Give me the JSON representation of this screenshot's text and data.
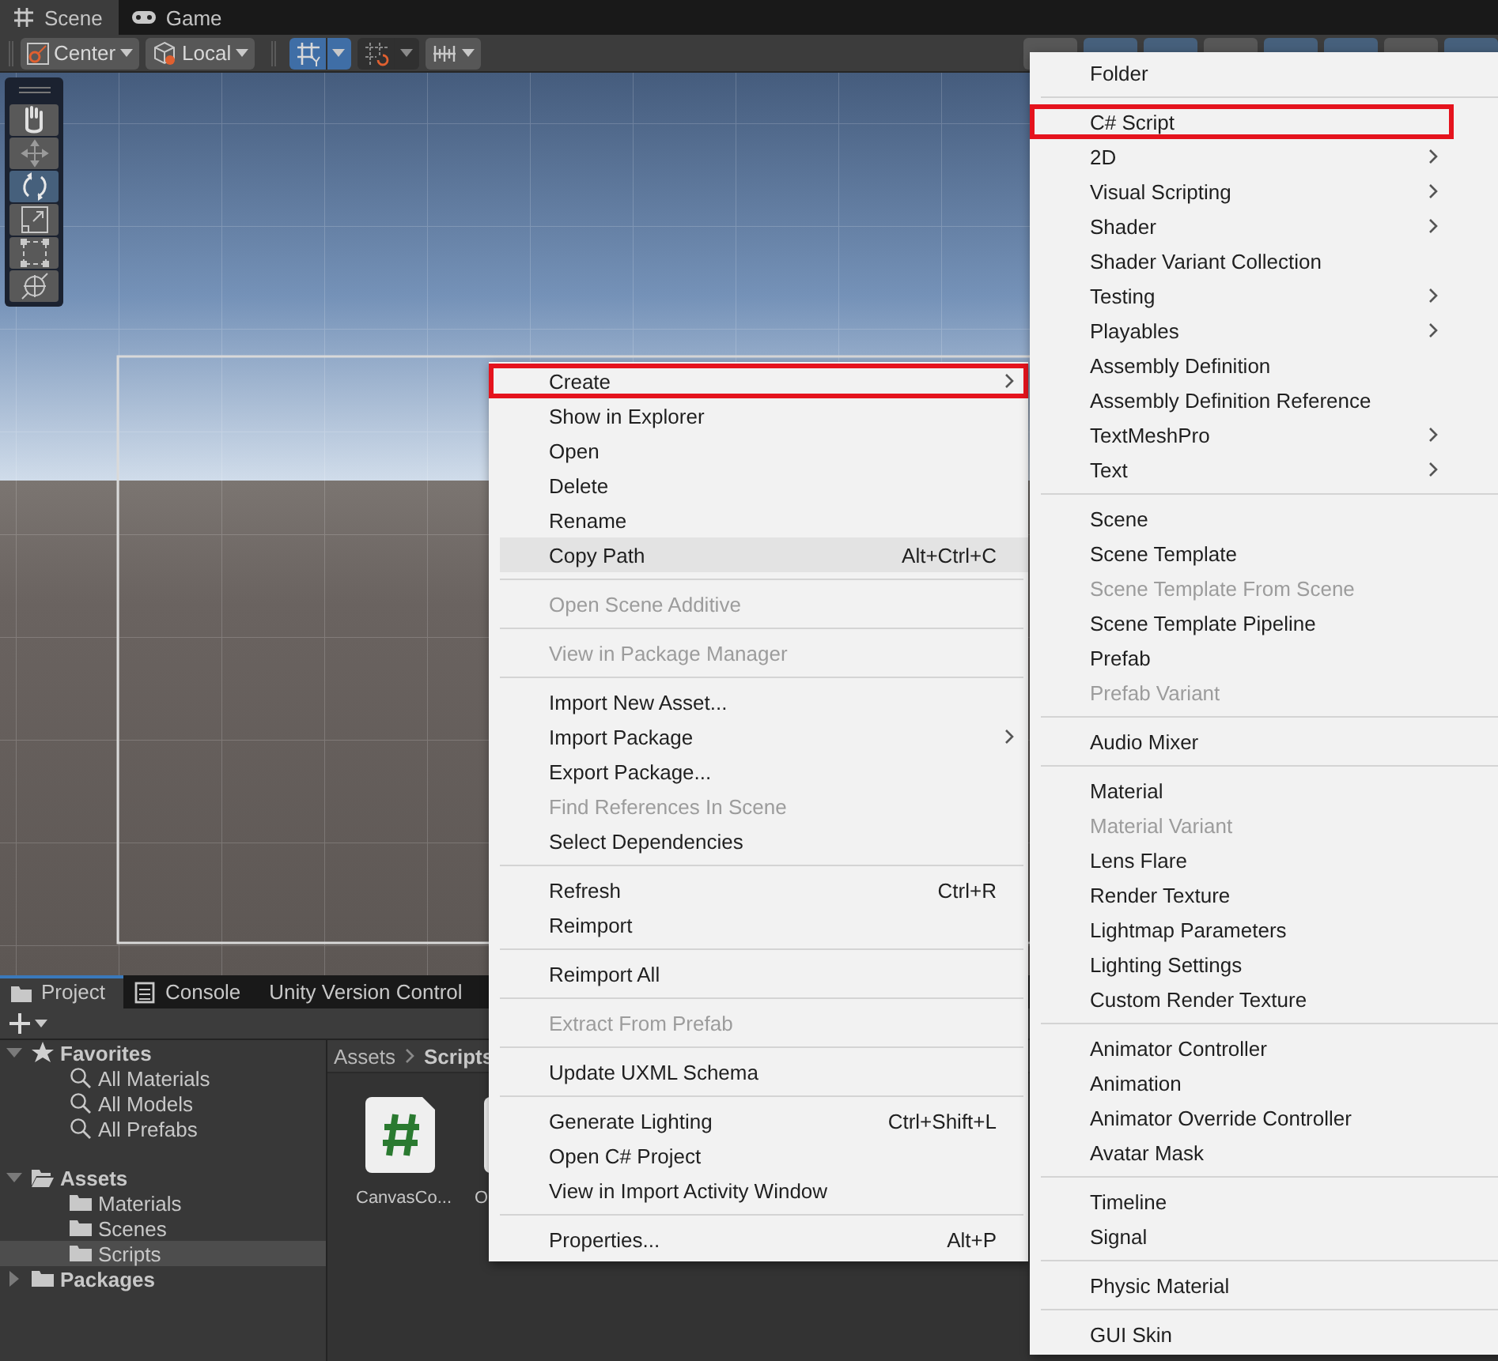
{
  "scene_window": {
    "tabs": [
      {
        "label": "Scene",
        "selected": true
      },
      {
        "label": "Game",
        "selected": false
      }
    ],
    "toolbar": {
      "pivot": {
        "label": "Center"
      },
      "space": {
        "label": "Local"
      },
      "grid_snapping": {
        "selected": true
      },
      "increment_snapping": {
        "selected": false
      },
      "right_buttons": [
        {
          "on": false
        },
        {
          "on": true
        },
        {
          "on": true
        },
        {
          "on": false
        },
        {
          "on": true
        },
        {
          "on": true
        },
        {
          "on": false
        },
        {
          "on": true
        }
      ]
    },
    "tools": [
      {
        "selected": false
      },
      {
        "selected": false
      },
      {
        "selected": true
      },
      {
        "selected": false
      },
      {
        "selected": false
      },
      {
        "selected": false
      }
    ]
  },
  "project_window": {
    "tabs": [
      {
        "label": "Project",
        "selected": true
      },
      {
        "label": "Console",
        "selected": false
      },
      {
        "label": "Unity Version Control",
        "selected": false
      }
    ],
    "tree": [
      {
        "label": "Favorites",
        "kind": "favorites",
        "expanded": true,
        "selected": false,
        "children": [
          {
            "label": "All Materials",
            "kind": "search",
            "selected": false
          },
          {
            "label": "All Models",
            "kind": "search",
            "selected": false
          },
          {
            "label": "All Prefabs",
            "kind": "search",
            "selected": false
          }
        ]
      },
      {
        "label": "Assets",
        "kind": "folder",
        "expanded": true,
        "selected": false,
        "children": [
          {
            "label": "Materials",
            "kind": "folder",
            "selected": false
          },
          {
            "label": "Scenes",
            "kind": "folder",
            "selected": false
          },
          {
            "label": "Scripts",
            "kind": "folder",
            "selected": true
          }
        ]
      },
      {
        "label": "Packages",
        "kind": "folder",
        "expanded": false,
        "selected": false
      }
    ],
    "breadcrumb": [
      "Assets",
      "Scripts"
    ],
    "files": [
      {
        "name": "CanvasCo..."
      },
      {
        "name": "O"
      }
    ]
  },
  "context_menu": {
    "items": [
      {
        "kind": "item",
        "label": "Create",
        "submenu": true,
        "disabled": false,
        "highlighted": false,
        "outlined": true
      },
      {
        "kind": "item",
        "label": "Show in Explorer",
        "submenu": false,
        "disabled": false,
        "highlighted": false,
        "outlined": false
      },
      {
        "kind": "item",
        "label": "Open",
        "submenu": false,
        "disabled": false,
        "highlighted": false,
        "outlined": false
      },
      {
        "kind": "item",
        "label": "Delete",
        "submenu": false,
        "disabled": false,
        "highlighted": false,
        "outlined": false
      },
      {
        "kind": "item",
        "label": "Rename",
        "submenu": false,
        "disabled": false,
        "highlighted": false,
        "outlined": false
      },
      {
        "kind": "item",
        "label": "Copy Path",
        "shortcut": "Alt+Ctrl+C",
        "submenu": false,
        "disabled": false,
        "highlighted": true,
        "outlined": false
      },
      {
        "kind": "separator"
      },
      {
        "kind": "item",
        "label": "Open Scene Additive",
        "submenu": false,
        "disabled": true,
        "highlighted": false,
        "outlined": false
      },
      {
        "kind": "separator"
      },
      {
        "kind": "item",
        "label": "View in Package Manager",
        "submenu": false,
        "disabled": true,
        "highlighted": false,
        "outlined": false
      },
      {
        "kind": "separator"
      },
      {
        "kind": "item",
        "label": "Import New Asset...",
        "submenu": false,
        "disabled": false,
        "highlighted": false,
        "outlined": false
      },
      {
        "kind": "item",
        "label": "Import Package",
        "submenu": true,
        "disabled": false,
        "highlighted": false,
        "outlined": false
      },
      {
        "kind": "item",
        "label": "Export Package...",
        "submenu": false,
        "disabled": false,
        "highlighted": false,
        "outlined": false
      },
      {
        "kind": "item",
        "label": "Find References In Scene",
        "submenu": false,
        "disabled": true,
        "highlighted": false,
        "outlined": false
      },
      {
        "kind": "item",
        "label": "Select Dependencies",
        "submenu": false,
        "disabled": false,
        "highlighted": false,
        "outlined": false
      },
      {
        "kind": "separator"
      },
      {
        "kind": "item",
        "label": "Refresh",
        "shortcut": "Ctrl+R",
        "submenu": false,
        "disabled": false,
        "highlighted": false,
        "outlined": false
      },
      {
        "kind": "item",
        "label": "Reimport",
        "submenu": false,
        "disabled": false,
        "highlighted": false,
        "outlined": false
      },
      {
        "kind": "separator"
      },
      {
        "kind": "item",
        "label": "Reimport All",
        "submenu": false,
        "disabled": false,
        "highlighted": false,
        "outlined": false
      },
      {
        "kind": "separator"
      },
      {
        "kind": "item",
        "label": "Extract From Prefab",
        "submenu": false,
        "disabled": true,
        "highlighted": false,
        "outlined": false
      },
      {
        "kind": "separator"
      },
      {
        "kind": "item",
        "label": "Update UXML Schema",
        "submenu": false,
        "disabled": false,
        "highlighted": false,
        "outlined": false
      },
      {
        "kind": "separator"
      },
      {
        "kind": "item",
        "label": "Generate Lighting",
        "shortcut": "Ctrl+Shift+L",
        "submenu": false,
        "disabled": false,
        "highlighted": false,
        "outlined": false
      },
      {
        "kind": "item",
        "label": "Open C# Project",
        "submenu": false,
        "disabled": false,
        "highlighted": false,
        "outlined": false
      },
      {
        "kind": "item",
        "label": "View in Import Activity Window",
        "submenu": false,
        "disabled": false,
        "highlighted": false,
        "outlined": false
      },
      {
        "kind": "separator"
      },
      {
        "kind": "item",
        "label": "Properties...",
        "shortcut": "Alt+P",
        "submenu": false,
        "disabled": false,
        "highlighted": false,
        "outlined": false
      }
    ]
  },
  "create_submenu": {
    "items": [
      {
        "kind": "item",
        "label": "Folder",
        "submenu": false,
        "disabled": false,
        "highlighted": false,
        "outlined": false
      },
      {
        "kind": "separator"
      },
      {
        "kind": "item",
        "label": "C# Script",
        "submenu": false,
        "disabled": false,
        "highlighted": false,
        "outlined": true
      },
      {
        "kind": "item",
        "label": "2D",
        "submenu": true,
        "disabled": false,
        "highlighted": false,
        "outlined": false
      },
      {
        "kind": "item",
        "label": "Visual Scripting",
        "submenu": true,
        "disabled": false,
        "highlighted": false,
        "outlined": false
      },
      {
        "kind": "item",
        "label": "Shader",
        "submenu": true,
        "disabled": false,
        "highlighted": false,
        "outlined": false
      },
      {
        "kind": "item",
        "label": "Shader Variant Collection",
        "submenu": false,
        "disabled": false,
        "highlighted": false,
        "outlined": false
      },
      {
        "kind": "item",
        "label": "Testing",
        "submenu": true,
        "disabled": false,
        "highlighted": false,
        "outlined": false
      },
      {
        "kind": "item",
        "label": "Playables",
        "submenu": true,
        "disabled": false,
        "highlighted": false,
        "outlined": false
      },
      {
        "kind": "item",
        "label": "Assembly Definition",
        "submenu": false,
        "disabled": false,
        "highlighted": false,
        "outlined": false
      },
      {
        "kind": "item",
        "label": "Assembly Definition Reference",
        "submenu": false,
        "disabled": false,
        "highlighted": false,
        "outlined": false
      },
      {
        "kind": "item",
        "label": "TextMeshPro",
        "submenu": true,
        "disabled": false,
        "highlighted": false,
        "outlined": false
      },
      {
        "kind": "item",
        "label": "Text",
        "submenu": true,
        "disabled": false,
        "highlighted": false,
        "outlined": false
      },
      {
        "kind": "separator"
      },
      {
        "kind": "item",
        "label": "Scene",
        "submenu": false,
        "disabled": false,
        "highlighted": false,
        "outlined": false
      },
      {
        "kind": "item",
        "label": "Scene Template",
        "submenu": false,
        "disabled": false,
        "highlighted": false,
        "outlined": false
      },
      {
        "kind": "item",
        "label": "Scene Template From Scene",
        "submenu": false,
        "disabled": true,
        "highlighted": false,
        "outlined": false
      },
      {
        "kind": "item",
        "label": "Scene Template Pipeline",
        "submenu": false,
        "disabled": false,
        "highlighted": false,
        "outlined": false
      },
      {
        "kind": "item",
        "label": "Prefab",
        "submenu": false,
        "disabled": false,
        "highlighted": false,
        "outlined": false
      },
      {
        "kind": "item",
        "label": "Prefab Variant",
        "submenu": false,
        "disabled": true,
        "highlighted": false,
        "outlined": false
      },
      {
        "kind": "separator"
      },
      {
        "kind": "item",
        "label": "Audio Mixer",
        "submenu": false,
        "disabled": false,
        "highlighted": false,
        "outlined": false
      },
      {
        "kind": "separator"
      },
      {
        "kind": "item",
        "label": "Material",
        "submenu": false,
        "disabled": false,
        "highlighted": false,
        "outlined": false
      },
      {
        "kind": "item",
        "label": "Material Variant",
        "submenu": false,
        "disabled": true,
        "highlighted": false,
        "outlined": false
      },
      {
        "kind": "item",
        "label": "Lens Flare",
        "submenu": false,
        "disabled": false,
        "highlighted": false,
        "outlined": false
      },
      {
        "kind": "item",
        "label": "Render Texture",
        "submenu": false,
        "disabled": false,
        "highlighted": false,
        "outlined": false
      },
      {
        "kind": "item",
        "label": "Lightmap Parameters",
        "submenu": false,
        "disabled": false,
        "highlighted": false,
        "outlined": false
      },
      {
        "kind": "item",
        "label": "Lighting Settings",
        "submenu": false,
        "disabled": false,
        "highlighted": false,
        "outlined": false
      },
      {
        "kind": "item",
        "label": "Custom Render Texture",
        "submenu": false,
        "disabled": false,
        "highlighted": false,
        "outlined": false
      },
      {
        "kind": "separator"
      },
      {
        "kind": "item",
        "label": "Animator Controller",
        "submenu": false,
        "disabled": false,
        "highlighted": false,
        "outlined": false
      },
      {
        "kind": "item",
        "label": "Animation",
        "submenu": false,
        "disabled": false,
        "highlighted": false,
        "outlined": false
      },
      {
        "kind": "item",
        "label": "Animator Override Controller",
        "submenu": false,
        "disabled": false,
        "highlighted": false,
        "outlined": false
      },
      {
        "kind": "item",
        "label": "Avatar Mask",
        "submenu": false,
        "disabled": false,
        "highlighted": false,
        "outlined": false
      },
      {
        "kind": "separator"
      },
      {
        "kind": "item",
        "label": "Timeline",
        "submenu": false,
        "disabled": false,
        "highlighted": false,
        "outlined": false
      },
      {
        "kind": "item",
        "label": "Signal",
        "submenu": false,
        "disabled": false,
        "highlighted": false,
        "outlined": false
      },
      {
        "kind": "separator"
      },
      {
        "kind": "item",
        "label": "Physic Material",
        "submenu": false,
        "disabled": false,
        "highlighted": false,
        "outlined": false
      },
      {
        "kind": "separator"
      },
      {
        "kind": "item",
        "label": "GUI Skin",
        "submenu": false,
        "disabled": false,
        "highlighted": false,
        "outlined": false
      }
    ]
  }
}
